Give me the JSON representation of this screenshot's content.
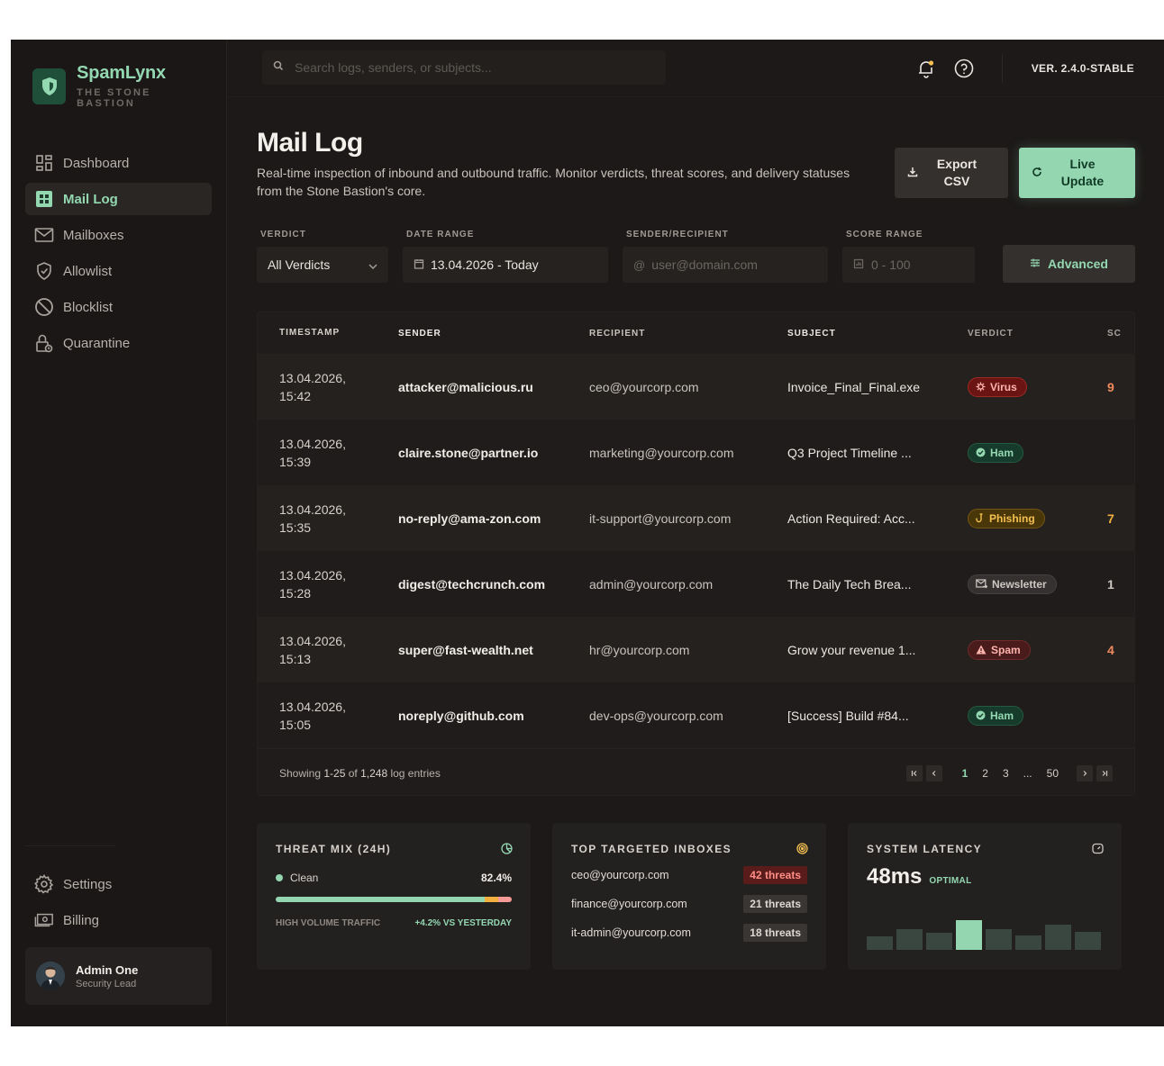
{
  "brand": {
    "name": "SpamLynx",
    "tagline": "THE STONE BASTION"
  },
  "nav": [
    {
      "label": "Dashboard",
      "icon": "dashboard-icon",
      "active": false
    },
    {
      "label": "Mail Log",
      "icon": "mail-log-icon",
      "active": true
    },
    {
      "label": "Mailboxes",
      "icon": "mailbox-icon",
      "active": false
    },
    {
      "label": "Allowlist",
      "icon": "shield-check-icon",
      "active": false
    },
    {
      "label": "Blocklist",
      "icon": "block-icon",
      "active": false
    },
    {
      "label": "Quarantine",
      "icon": "lock-icon",
      "active": false
    }
  ],
  "nav_bottom": [
    {
      "label": "Settings",
      "icon": "gear-icon"
    },
    {
      "label": "Billing",
      "icon": "billing-icon"
    }
  ],
  "user": {
    "name": "Admin One",
    "role": "Security Lead"
  },
  "topbar": {
    "search_placeholder": "Search logs, senders, or subjects...",
    "version": "VER. 2.4.0-STABLE"
  },
  "page": {
    "title": "Mail Log",
    "description": "Real-time inspection of inbound and outbound traffic. Monitor verdicts, threat scores, and delivery statuses from the Stone Bastion's core.",
    "export_line1": "Export",
    "export_line2": "CSV",
    "live_line1": "Live",
    "live_line2": "Update"
  },
  "filters": {
    "verdict_label": "VERDICT",
    "verdict_value": "All Verdicts",
    "date_label": "DATE RANGE",
    "date_value": "13.04.2026 - Today",
    "sender_label": "SENDER/RECIPIENT",
    "sender_placeholder": "user@domain.com",
    "score_label": "SCORE RANGE",
    "score_placeholder": "0 - 100",
    "advanced": "Advanced"
  },
  "table": {
    "columns": [
      "TIMESTAMP",
      "SENDER",
      "RECIPIENT",
      "SUBJECT",
      "VERDICT",
      "SC"
    ],
    "rows": [
      {
        "date": "13.04.2026,",
        "time": "15:42",
        "sender": "attacker@malicious.ru",
        "recipient": "ceo@yourcorp.com",
        "subject": "Invoice_Final_Final.exe",
        "verdict": "Virus",
        "score": "9",
        "score_color": "#f08a5d"
      },
      {
        "date": "13.04.2026,",
        "time": "15:39",
        "sender": "claire.stone@partner.io",
        "recipient": "marketing@yourcorp.com",
        "subject": "Q3 Project Timeline ...",
        "verdict": "Ham",
        "score": "",
        "score_color": "#cdc7c1"
      },
      {
        "date": "13.04.2026,",
        "time": "15:35",
        "sender": "no-reply@ama-zon.com",
        "recipient": "it-support@yourcorp.com",
        "subject": "Action Required: Acc...",
        "verdict": "Phishing",
        "score": "7",
        "score_color": "#f4b03f"
      },
      {
        "date": "13.04.2026,",
        "time": "15:28",
        "sender": "digest@techcrunch.com",
        "recipient": "admin@yourcorp.com",
        "subject": "The Daily Tech Brea...",
        "verdict": "Newsletter",
        "score": "1",
        "score_color": "#cdc7c1"
      },
      {
        "date": "13.04.2026,",
        "time": "15:13",
        "sender": "super@fast-wealth.net",
        "recipient": "hr@yourcorp.com",
        "subject": "Grow your revenue 1...",
        "verdict": "Spam",
        "score": "4",
        "score_color": "#f08a5d"
      },
      {
        "date": "13.04.2026,",
        "time": "15:05",
        "sender": "noreply@github.com",
        "recipient": "dev-ops@yourcorp.com",
        "subject": "[Success] Build #84...",
        "verdict": "Ham",
        "score": "",
        "score_color": "#cdc7c1"
      }
    ],
    "footer": {
      "showing_prefix": "Showing ",
      "range": "1-25",
      "of": " of ",
      "total": "1,248",
      "suffix": " log entries"
    },
    "pages": [
      "1",
      "2",
      "3",
      "...",
      "50"
    ]
  },
  "stats": {
    "threat_mix": {
      "title": "THREAT MIX (24H)",
      "label": "Clean",
      "value": "82.4%",
      "clean_fraction": 0.884,
      "phish_fraction": 0.06,
      "spam_fraction": 0.056,
      "foot_left": "HIGH VOLUME TRAFFIC",
      "foot_right": "+4.2% VS YESTERDAY"
    },
    "top_inboxes": {
      "title": "TOP TARGETED INBOXES",
      "items": [
        {
          "email": "ceo@yourcorp.com",
          "threats": "42 threats",
          "severity": "high"
        },
        {
          "email": "finance@yourcorp.com",
          "threats": "21 threats",
          "severity": "normal"
        },
        {
          "email": "it-admin@yourcorp.com",
          "threats": "18 threats",
          "severity": "normal"
        }
      ]
    },
    "latency": {
      "title": "SYSTEM LATENCY",
      "value": "48ms",
      "status": "OPTIMAL",
      "bars": [
        0.38,
        0.58,
        0.48,
        0.82,
        0.58,
        0.4,
        0.7,
        0.5
      ],
      "highlight_index": 3
    }
  },
  "colors": {
    "accent": "#93d8b1",
    "virus": "#ffb3ad",
    "phishing": "#f4c04f"
  }
}
